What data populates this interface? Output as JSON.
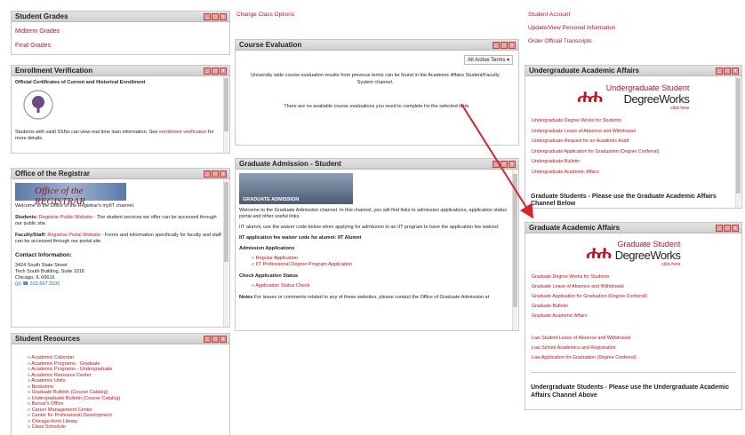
{
  "left": {
    "student_grades": {
      "title": "Student Grades",
      "links": [
        "Midterm Grades",
        "Final Grades"
      ]
    },
    "enrollment": {
      "title": "Enrollment Verification",
      "heading": "Official Certificates of Current and Historical Enrollment",
      "note": "Students with valid SSNs can view real time loan information. See ",
      "note_link": "enrollment verification",
      "note_end": " for more details."
    },
    "registrar": {
      "title": "Office of the Registrar",
      "banner_label": "Office of the REGISTRAR",
      "welcome": "Welcome to the Office of the Registrar's myIIT channel.",
      "students_label": "Students: ",
      "students_link": "Registrar Public Website",
      "students_text": " - The student services we offer can be accessed through our public site.",
      "faculty_label": "Faculty/Staff: ",
      "faculty_link": "Registrar Portal Website",
      "faculty_text": " - Forms and information specifically for faculty and staff can be accessed through our portal site.",
      "contact_heading": "Contact Information:",
      "address": [
        "3424 South State Street",
        "Tech South Building, Suite 1016",
        "Chicago, IL 60616"
      ],
      "phone": "312.567.3100"
    },
    "resources": {
      "title": "Student Resources",
      "items": [
        "Academic Calendar",
        "Academic Programs - Graduate",
        "Academic Programs - Undergraduate",
        "Academic Resource Center",
        "Academic Units",
        "Bookstore",
        "Graduate Bulletin (Course Catalog)",
        "Undergraduate Bulletin (Course Catalog)",
        "Bursar's Office",
        "Career Management Center",
        "Center for Professional Development",
        "Chicago-Kent Library",
        "Class Schedule"
      ]
    }
  },
  "middle": {
    "top_link": "Change Class Options",
    "course_eval": {
      "title": "Course Evaluation",
      "dropdown": "All Active Terms",
      "info": "University wide course evaluation results from previous terms can be found in the Academic Affairs Student/Faculty System channel.",
      "empty": "There are no available course evaluations you need to complete for the selected term."
    },
    "grad_admission": {
      "title": "Graduate Admission - Student",
      "banner_label": "GRADUATE ADMISSION",
      "intro": "Welcome to the Graduate Admission channel. In this channel, you will find links to admission applications, application status portal and other useful links.",
      "alumni": "IIT alumni, use the waiver code below when applying for admission to an IIT program to have the application fee waived.",
      "waiver": "IIT application fee waiver code for alumni: IIT Alumni",
      "apps_heading": "Admission Applications",
      "apps": [
        "Regular Application",
        "IIT Professional Degree Program Application"
      ],
      "status_heading": "Check Application Status",
      "status": [
        "Application Status Check"
      ],
      "notes_label": "Notes",
      "notes_text": " For issues or comments related to any of these websites, please contact the Office of Graduate Admission at"
    }
  },
  "right": {
    "top_links": [
      "Student Account",
      "Update/View Personal Information",
      "Order Official Transcripts"
    ],
    "ugaa": {
      "title": "Undergraduate Academic Affairs",
      "logo_line1": "Undergraduate Student",
      "logo_line2": "DegreeWorks",
      "logo_click": "click here",
      "links": [
        "Undergraduate Degree Works for Students",
        "Undergraduate Leave of Absence and Withdrawal",
        "Undergraduate Request for an Academic Audit",
        "Undergraduate Application for Graduation (Degree Conferral)",
        "Undergraduate Bulletin",
        "Undergraduate Academic Affairs"
      ],
      "footer": "Graduate Students - Please use the Graduate Academic Affairs Channel Below"
    },
    "gaa": {
      "title": "Graduate Academic Affairs",
      "logo_line1": "Graduate Student",
      "logo_line2": "DegreeWorks",
      "logo_click": "click here",
      "links": [
        "Graduate Degree Works for Students",
        "Graduate Leave of Absence and Withdrawal",
        "Graduate Application for Graduation (Degree Conferral)",
        "Graduate Bulletin",
        "Graduate Academic Affairs"
      ],
      "law_links": [
        "Law Student Leave of Absence and Withdrawal",
        "Law School Academics and Registration",
        "Law Application for Graduation (Degree Conferral)"
      ],
      "footer": "Undergraduate Students - Please use the Undergraduate Academic Affairs Channel Above"
    }
  },
  "window_controls": [
    "_",
    "□",
    "x"
  ],
  "colors": {
    "link": "#c0141e",
    "arrow": "#e0202a",
    "header_bg": "#d6d6d6"
  }
}
